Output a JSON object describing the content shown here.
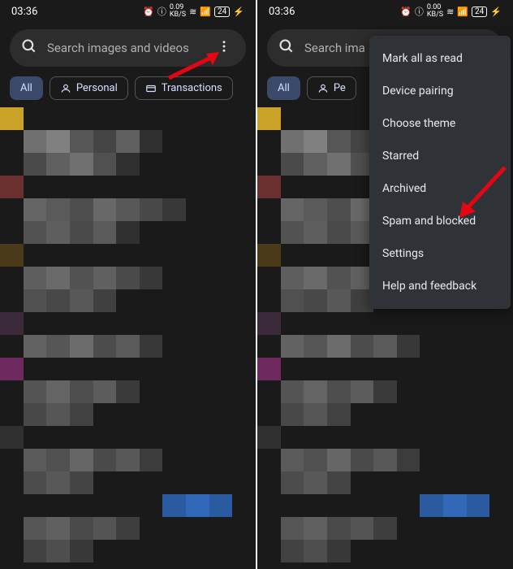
{
  "status": {
    "time": "03:36",
    "kbps": "0.09",
    "kbps2": "0.00",
    "kbps_label": "KB/S",
    "battery": "24"
  },
  "search": {
    "placeholder_full": "Search images and videos",
    "placeholder_short": "Search ima"
  },
  "chips": {
    "all": "All",
    "personal": "Personal",
    "transactions": "Transactions",
    "personal_short": "Pe"
  },
  "menu": {
    "items": [
      "Mark all as read",
      "Device pairing",
      "Choose theme",
      "Starred",
      "Archived",
      "Spam and blocked",
      "Settings",
      "Help and feedback"
    ]
  },
  "colors": {
    "accent": "#3b4a6b",
    "menu_bg": "#2f3237",
    "arrow": "#e30613"
  }
}
